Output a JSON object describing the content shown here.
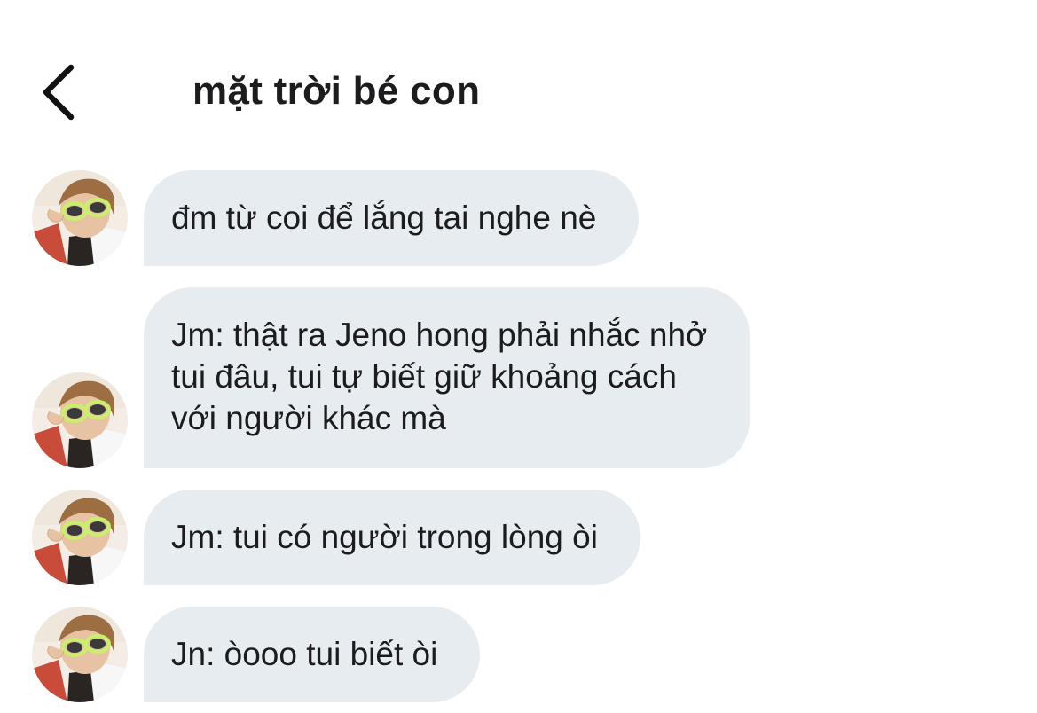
{
  "header": {
    "title": "mặt trời bé con",
    "back_icon": "chevron-left-icon"
  },
  "colors": {
    "bubble_background": "#e7ecf1",
    "text": "#1c1c1e",
    "background": "#ffffff"
  },
  "messages": [
    {
      "lines": [
        "đm từ coi để lắng tai nghe nè"
      ]
    },
    {
      "lines": [
        "Jm: thật ra Jeno hong phải nhắc nhở",
        "tui đâu, tui tự biết giữ khoảng cách",
        "với người khác mà"
      ]
    },
    {
      "lines": [
        "Jm: tui có người trong lòng òi"
      ]
    },
    {
      "lines": [
        "Jn: òooo tui biết òi"
      ]
    }
  ]
}
